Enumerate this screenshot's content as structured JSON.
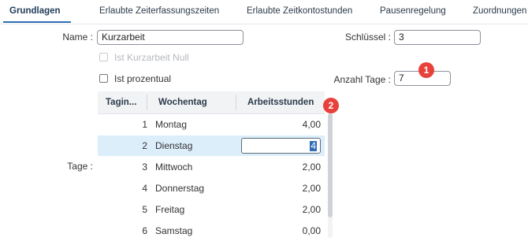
{
  "tabs": [
    {
      "label": "Grundlagen",
      "active": true
    },
    {
      "label": "Erlaubte Zeiterfassungszeiten"
    },
    {
      "label": "Erlaubte Zeitkontostunden"
    },
    {
      "label": "Pausenregelung"
    },
    {
      "label": "Zuordnungen"
    }
  ],
  "form": {
    "name_label": "Name :",
    "name_value": "Kurzarbeit",
    "schluessel_label": "Schlüssel :",
    "schluessel_value": "3",
    "null_label": "Ist Kurzarbeit Null",
    "prozentual_label": "Ist prozentual",
    "anzahl_label": "Anzahl Tage :",
    "anzahl_value": "7",
    "tage_label": "Tage :"
  },
  "badges": [
    "1",
    "2"
  ],
  "grid": {
    "headers": [
      "Tagin...",
      "Wochentag",
      "Arbeitsstunden"
    ],
    "rows": [
      {
        "index": "1",
        "day": "Montag",
        "hours": "4,00"
      },
      {
        "index": "2",
        "day": "Dienstag",
        "hours": "4",
        "editing": true
      },
      {
        "index": "3",
        "day": "Mittwoch",
        "hours": "2,00"
      },
      {
        "index": "4",
        "day": "Donnerstag",
        "hours": "2,00"
      },
      {
        "index": "5",
        "day": "Freitag",
        "hours": "2,00"
      },
      {
        "index": "6",
        "day": "Samstag",
        "hours": "0,00"
      }
    ]
  }
}
